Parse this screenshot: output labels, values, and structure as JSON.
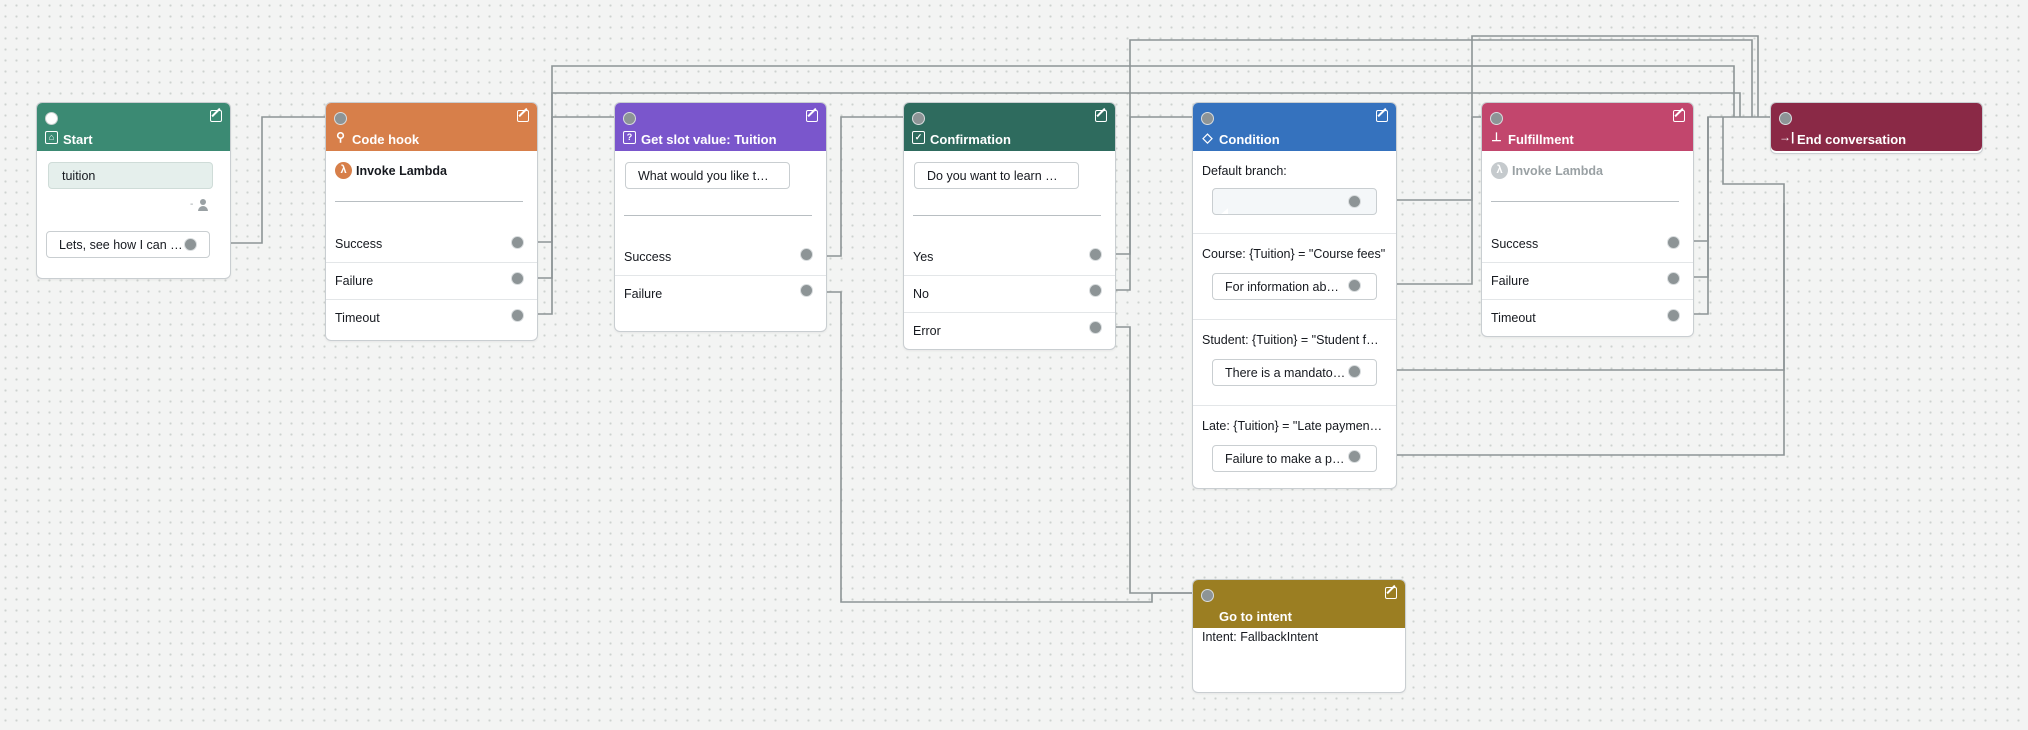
{
  "colors": {
    "start": "#3b8a73",
    "code_hook": "#d77f4a",
    "get_slot": "#7a56cc",
    "confirmation": "#2e6b5e",
    "condition": "#3572be",
    "fulfillment": "#c2466d",
    "end": "#8a2946",
    "goto": "#9b7e22",
    "wire": "#8d9496"
  },
  "start": {
    "title": "Start",
    "icon": "start-icon",
    "utterance": "tuition",
    "response": "Lets, see how I can …"
  },
  "code_hook": {
    "title": "Code hook",
    "icon": "code-hook-icon",
    "action": "Invoke Lambda",
    "outputs": [
      "Success",
      "Failure",
      "Timeout"
    ]
  },
  "get_slot": {
    "title": "Get slot value: Tuition",
    "icon": "question-icon",
    "prompt": "What would you like t…",
    "outputs": [
      "Success",
      "Failure"
    ]
  },
  "confirmation": {
    "title": "Confirmation",
    "icon": "check-icon",
    "prompt": "Do you want to learn …",
    "outputs": [
      "Yes",
      "No",
      "Error"
    ]
  },
  "condition": {
    "title": "Condition",
    "icon": "diamond-icon",
    "branches": [
      {
        "label": "Default branch:",
        "message": ""
      },
      {
        "label": "Course: {Tuition} = \"Course fees\"",
        "message": "For information ab…"
      },
      {
        "label": "Student: {Tuition} = \"Student f…",
        "message": "There is a mandato…"
      },
      {
        "label": "Late: {Tuition} = \"Late paymen…",
        "message": "Failure to make a p…"
      }
    ]
  },
  "fulfillment": {
    "title": "Fulfillment",
    "icon": "fulfillment-icon",
    "action": "Invoke Lambda",
    "outputs": [
      "Success",
      "Failure",
      "Timeout"
    ]
  },
  "end": {
    "title": "End conversation",
    "icon": "exit-icon"
  },
  "goto": {
    "title": "Go to intent",
    "intent": "Intent: FallbackIntent"
  }
}
